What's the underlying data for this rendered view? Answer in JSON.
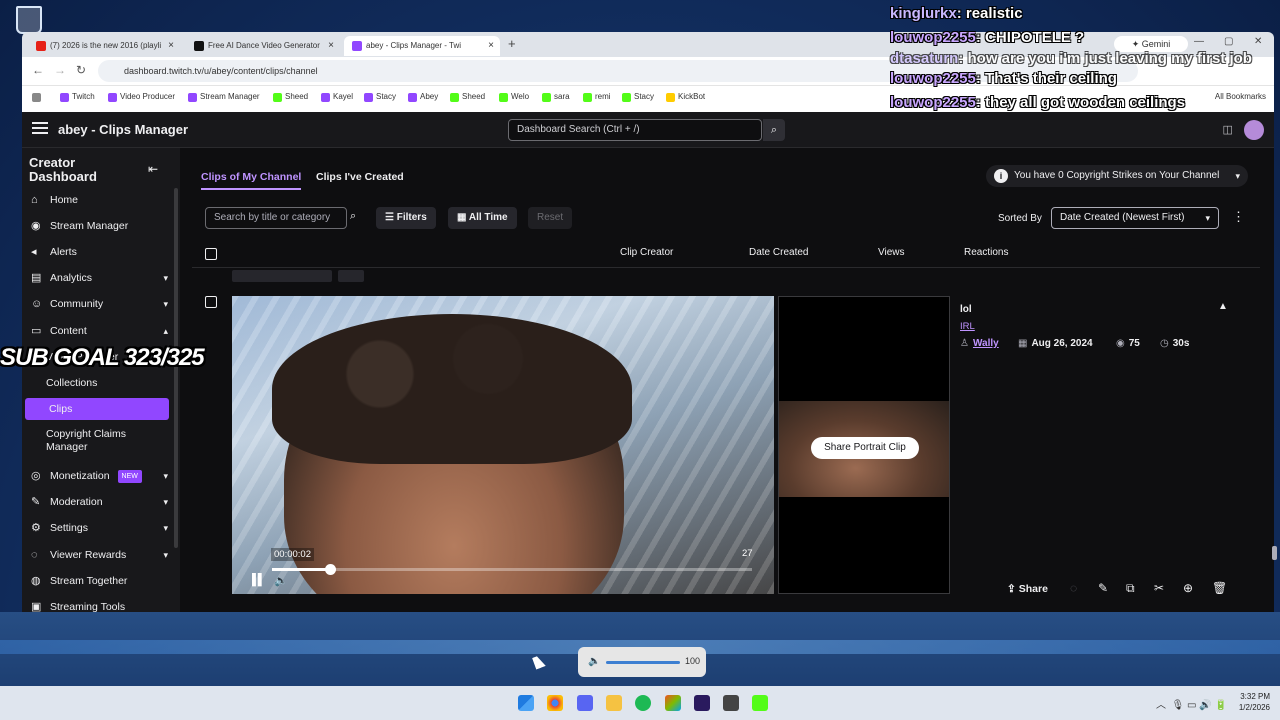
{
  "chrome": {
    "tabs": [
      {
        "label": "(7) 2026 is the new 2016 (playli",
        "color": "#e62117"
      },
      {
        "label": "Free AI Dance Video Generator",
        "color": "#111111"
      },
      {
        "label": "abey - Clips Manager - Twi",
        "color": "#9147ff"
      }
    ],
    "new_tab": "+",
    "gemini": "Gemini",
    "url": "dashboard.twitch.tv/u/abey/content/clips/channel",
    "bookmarks": [
      {
        "label": "Twitch",
        "color": "#9147ff"
      },
      {
        "label": "Video Producer",
        "color": "#9147ff"
      },
      {
        "label": "Stream Manager",
        "color": "#9147ff"
      },
      {
        "label": "Sheed",
        "color": "#53fc18"
      },
      {
        "label": "Kayel",
        "color": "#9147ff"
      },
      {
        "label": "Stacy",
        "color": "#9147ff"
      },
      {
        "label": "Abey",
        "color": "#9147ff"
      },
      {
        "label": "Sheed",
        "color": "#53fc18"
      },
      {
        "label": "Welo",
        "color": "#53fc18"
      },
      {
        "label": "sara",
        "color": "#53fc18"
      },
      {
        "label": "remi",
        "color": "#53fc18"
      },
      {
        "label": "Stacy",
        "color": "#53fc18"
      },
      {
        "label": "KickBot",
        "color": "#ffcc00"
      }
    ],
    "all_bookmarks": "All Bookmarks"
  },
  "twitch": {
    "title": "abey - Clips Manager",
    "search_placeholder": "Dashboard Search (Ctrl + /)"
  },
  "sidebar": {
    "title": "Creator Dashboard",
    "items": [
      {
        "label": "Home",
        "icon": "⌂"
      },
      {
        "label": "Stream Manager",
        "icon": "◉"
      },
      {
        "label": "Alerts",
        "icon": "◂"
      },
      {
        "label": "Analytics",
        "icon": "▤",
        "chev": "▾"
      },
      {
        "label": "Community",
        "icon": "☺",
        "chev": "▾"
      },
      {
        "label": "Content",
        "icon": "▭",
        "chev": "▴"
      },
      {
        "label": "Video Producer",
        "icon": ""
      },
      {
        "label": "Collections",
        "icon": ""
      },
      {
        "label": "Clips",
        "icon": ""
      },
      {
        "label": "Copyright Claims Manager",
        "icon": ""
      },
      {
        "label": "Monetization",
        "icon": "◎",
        "chev": "▾",
        "badge": "NEW"
      },
      {
        "label": "Moderation",
        "icon": "✎",
        "chev": "▾"
      },
      {
        "label": "Settings",
        "icon": "⚙",
        "chev": "▾"
      },
      {
        "label": "Viewer Rewards",
        "icon": "◌",
        "chev": "▾"
      },
      {
        "label": "Stream Together",
        "icon": "◍"
      },
      {
        "label": "Streaming Tools",
        "icon": "▣"
      }
    ]
  },
  "clips": {
    "tabs": [
      "Clips of My Channel",
      "Clips I've Created"
    ],
    "strikes": "You have 0 Copyright Strikes on Your Channel",
    "search_placeholder": "Search by title or category",
    "filters": "Filters",
    "all_time": "All Time",
    "reset": "Reset",
    "sorted_by": "Sorted By",
    "sort_value": "Date Created (Newest First)",
    "columns": [
      "Clip Creator",
      "Date Created",
      "Views",
      "Reactions"
    ],
    "clip": {
      "title": "lol",
      "category": "IRL",
      "creator": "Wally",
      "date": "Aug 26, 2024",
      "views": "75",
      "duration": "30s",
      "current_time": "00:00:02",
      "end_time": "27",
      "progress": 0.12,
      "share_portrait": "Share Portrait Clip",
      "share": "Share"
    }
  },
  "overlay": {
    "chat": [
      {
        "user": "kinglurkx",
        "msg": "realistic"
      },
      {
        "user": "louwop2255",
        "msg": "CHIPOTELE ?"
      },
      {
        "user": "dtasaturn",
        "msg": "how are you i'm just leaving my first job"
      },
      {
        "user": "louwop2255",
        "msg": "That's their ceiling"
      },
      {
        "user": "louwop2255",
        "msg": "they all got wooden ceilings"
      }
    ],
    "subgoal": "SUB GOAL 323/325"
  },
  "system": {
    "volume": "100",
    "time": "3:32 PM",
    "date": "1/2/2026"
  }
}
